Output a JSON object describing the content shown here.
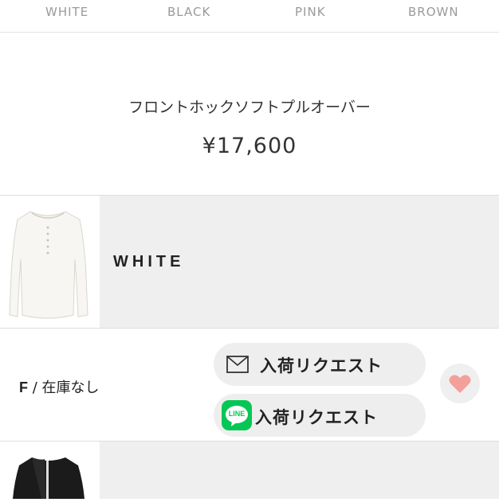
{
  "tabs": [
    "WHITE",
    "BLACK",
    "PINK",
    "BROWN"
  ],
  "product": {
    "name": "フロントホックソフトプルオーバー",
    "price": "¥17,600"
  },
  "variants": [
    {
      "color_label": "WHITE"
    },
    {
      "color_label": ""
    }
  ],
  "stock": {
    "size": "F",
    "separator": " / ",
    "status": "在庫なし",
    "mail_request_label": "入荷リクエスト",
    "line_request_label": "入荷リクエスト",
    "line_icon_text": "LINE"
  },
  "colors": {
    "line_green": "#06c755",
    "heart": "#f4a09a",
    "panel_bg": "#efefef"
  },
  "icons": [
    "mail-icon",
    "line-icon",
    "heart-icon"
  ]
}
